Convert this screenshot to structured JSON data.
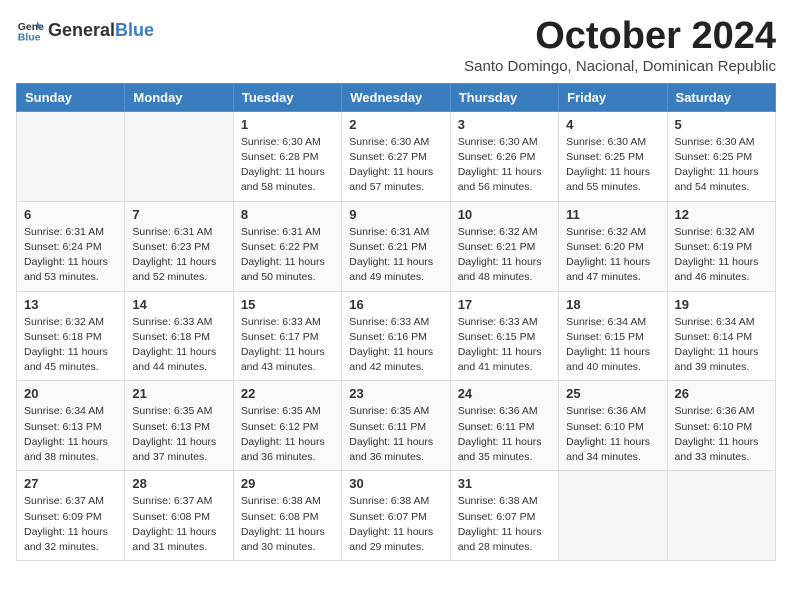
{
  "logo": {
    "text_general": "General",
    "text_blue": "Blue"
  },
  "title": "October 2024",
  "subtitle": "Santo Domingo, Nacional, Dominican Republic",
  "days_header": [
    "Sunday",
    "Monday",
    "Tuesday",
    "Wednesday",
    "Thursday",
    "Friday",
    "Saturday"
  ],
  "weeks": [
    [
      {
        "day": "",
        "info": ""
      },
      {
        "day": "",
        "info": ""
      },
      {
        "day": "1",
        "info": "Sunrise: 6:30 AM\nSunset: 6:28 PM\nDaylight: 11 hours\nand 58 minutes."
      },
      {
        "day": "2",
        "info": "Sunrise: 6:30 AM\nSunset: 6:27 PM\nDaylight: 11 hours\nand 57 minutes."
      },
      {
        "day": "3",
        "info": "Sunrise: 6:30 AM\nSunset: 6:26 PM\nDaylight: 11 hours\nand 56 minutes."
      },
      {
        "day": "4",
        "info": "Sunrise: 6:30 AM\nSunset: 6:25 PM\nDaylight: 11 hours\nand 55 minutes."
      },
      {
        "day": "5",
        "info": "Sunrise: 6:30 AM\nSunset: 6:25 PM\nDaylight: 11 hours\nand 54 minutes."
      }
    ],
    [
      {
        "day": "6",
        "info": "Sunrise: 6:31 AM\nSunset: 6:24 PM\nDaylight: 11 hours\nand 53 minutes."
      },
      {
        "day": "7",
        "info": "Sunrise: 6:31 AM\nSunset: 6:23 PM\nDaylight: 11 hours\nand 52 minutes."
      },
      {
        "day": "8",
        "info": "Sunrise: 6:31 AM\nSunset: 6:22 PM\nDaylight: 11 hours\nand 50 minutes."
      },
      {
        "day": "9",
        "info": "Sunrise: 6:31 AM\nSunset: 6:21 PM\nDaylight: 11 hours\nand 49 minutes."
      },
      {
        "day": "10",
        "info": "Sunrise: 6:32 AM\nSunset: 6:21 PM\nDaylight: 11 hours\nand 48 minutes."
      },
      {
        "day": "11",
        "info": "Sunrise: 6:32 AM\nSunset: 6:20 PM\nDaylight: 11 hours\nand 47 minutes."
      },
      {
        "day": "12",
        "info": "Sunrise: 6:32 AM\nSunset: 6:19 PM\nDaylight: 11 hours\nand 46 minutes."
      }
    ],
    [
      {
        "day": "13",
        "info": "Sunrise: 6:32 AM\nSunset: 6:18 PM\nDaylight: 11 hours\nand 45 minutes."
      },
      {
        "day": "14",
        "info": "Sunrise: 6:33 AM\nSunset: 6:18 PM\nDaylight: 11 hours\nand 44 minutes."
      },
      {
        "day": "15",
        "info": "Sunrise: 6:33 AM\nSunset: 6:17 PM\nDaylight: 11 hours\nand 43 minutes."
      },
      {
        "day": "16",
        "info": "Sunrise: 6:33 AM\nSunset: 6:16 PM\nDaylight: 11 hours\nand 42 minutes."
      },
      {
        "day": "17",
        "info": "Sunrise: 6:33 AM\nSunset: 6:15 PM\nDaylight: 11 hours\nand 41 minutes."
      },
      {
        "day": "18",
        "info": "Sunrise: 6:34 AM\nSunset: 6:15 PM\nDaylight: 11 hours\nand 40 minutes."
      },
      {
        "day": "19",
        "info": "Sunrise: 6:34 AM\nSunset: 6:14 PM\nDaylight: 11 hours\nand 39 minutes."
      }
    ],
    [
      {
        "day": "20",
        "info": "Sunrise: 6:34 AM\nSunset: 6:13 PM\nDaylight: 11 hours\nand 38 minutes."
      },
      {
        "day": "21",
        "info": "Sunrise: 6:35 AM\nSunset: 6:13 PM\nDaylight: 11 hours\nand 37 minutes."
      },
      {
        "day": "22",
        "info": "Sunrise: 6:35 AM\nSunset: 6:12 PM\nDaylight: 11 hours\nand 36 minutes."
      },
      {
        "day": "23",
        "info": "Sunrise: 6:35 AM\nSunset: 6:11 PM\nDaylight: 11 hours\nand 36 minutes."
      },
      {
        "day": "24",
        "info": "Sunrise: 6:36 AM\nSunset: 6:11 PM\nDaylight: 11 hours\nand 35 minutes."
      },
      {
        "day": "25",
        "info": "Sunrise: 6:36 AM\nSunset: 6:10 PM\nDaylight: 11 hours\nand 34 minutes."
      },
      {
        "day": "26",
        "info": "Sunrise: 6:36 AM\nSunset: 6:10 PM\nDaylight: 11 hours\nand 33 minutes."
      }
    ],
    [
      {
        "day": "27",
        "info": "Sunrise: 6:37 AM\nSunset: 6:09 PM\nDaylight: 11 hours\nand 32 minutes."
      },
      {
        "day": "28",
        "info": "Sunrise: 6:37 AM\nSunset: 6:08 PM\nDaylight: 11 hours\nand 31 minutes."
      },
      {
        "day": "29",
        "info": "Sunrise: 6:38 AM\nSunset: 6:08 PM\nDaylight: 11 hours\nand 30 minutes."
      },
      {
        "day": "30",
        "info": "Sunrise: 6:38 AM\nSunset: 6:07 PM\nDaylight: 11 hours\nand 29 minutes."
      },
      {
        "day": "31",
        "info": "Sunrise: 6:38 AM\nSunset: 6:07 PM\nDaylight: 11 hours\nand 28 minutes."
      },
      {
        "day": "",
        "info": ""
      },
      {
        "day": "",
        "info": ""
      }
    ]
  ]
}
